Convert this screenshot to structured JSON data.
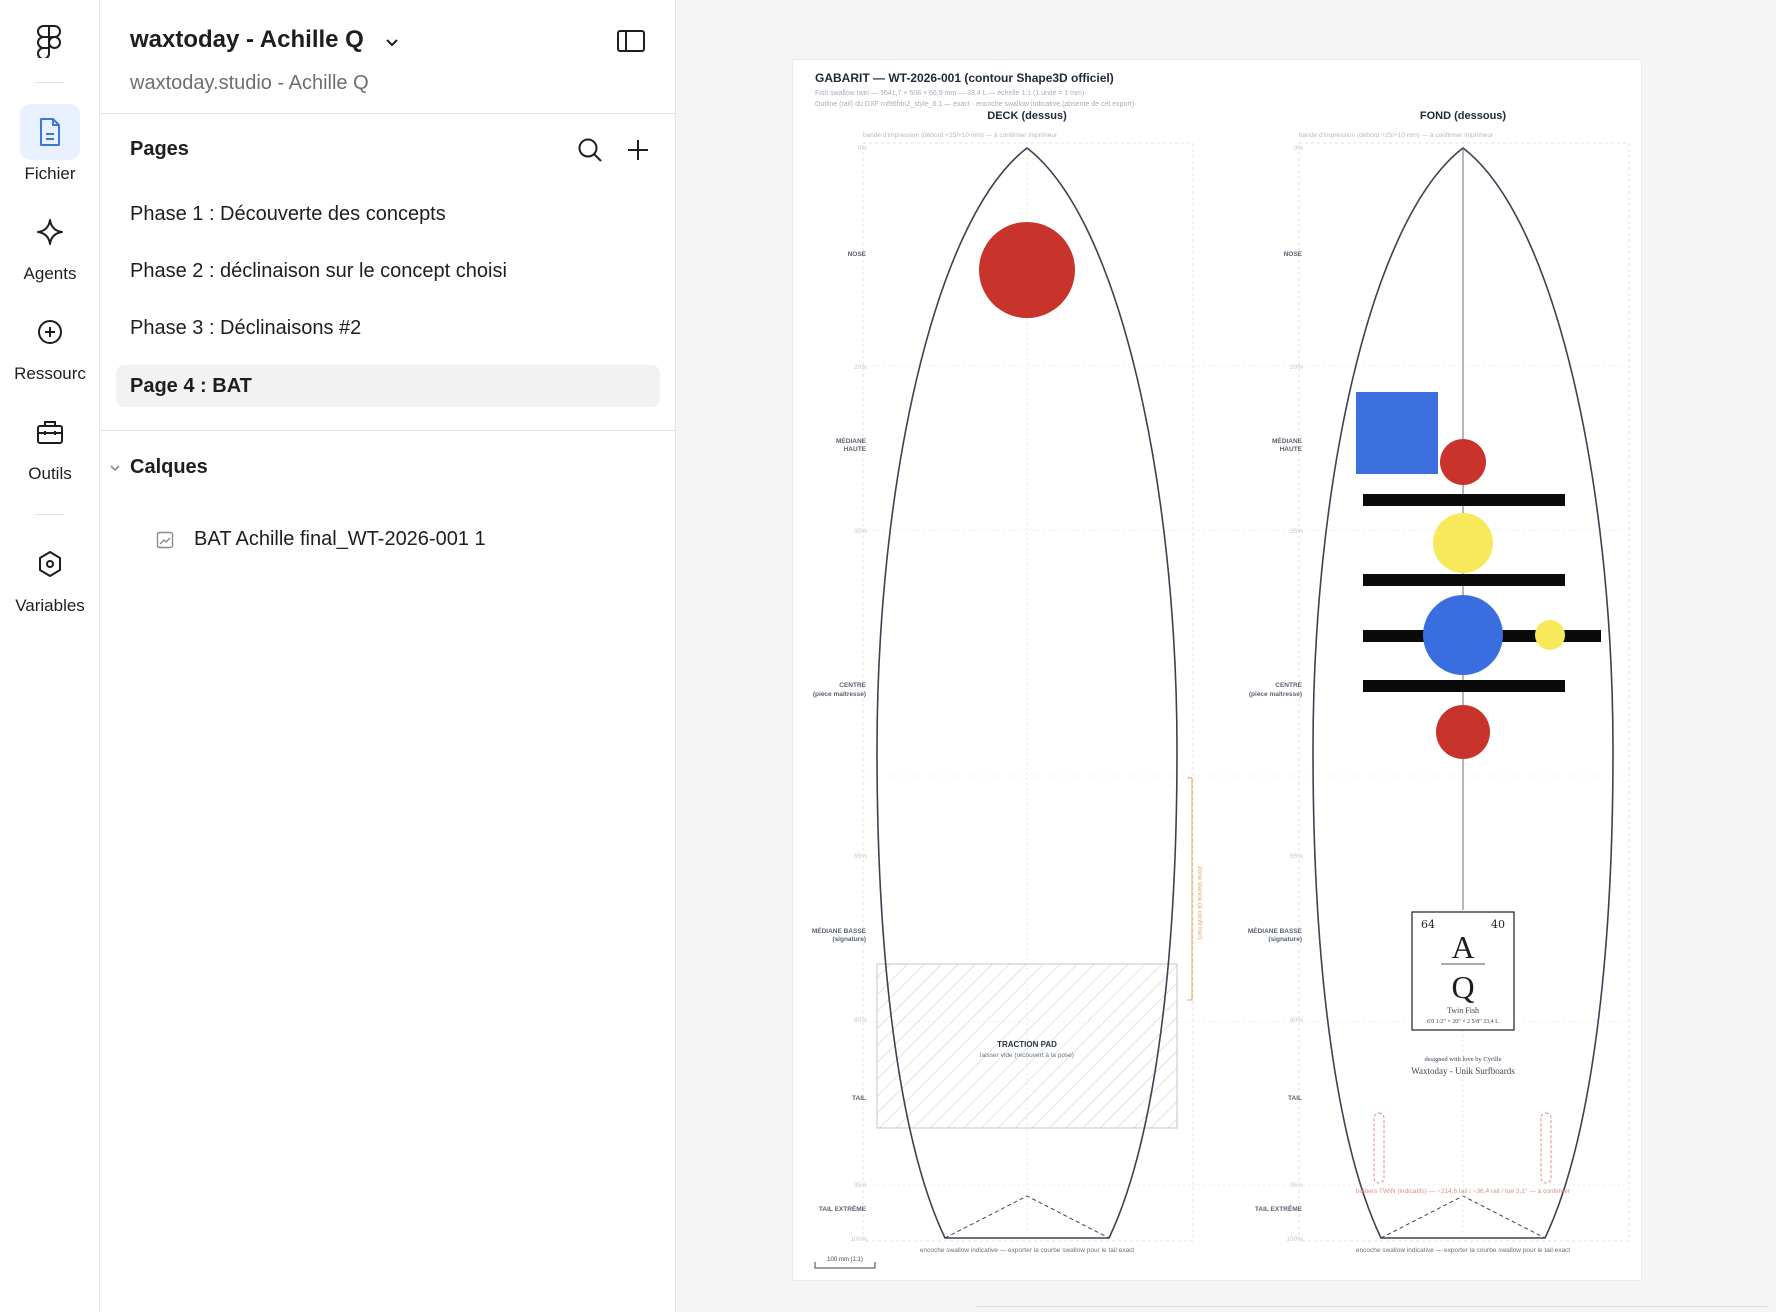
{
  "rail": {
    "items": [
      {
        "label": "Fichier",
        "icon": "file-icon",
        "active": true
      },
      {
        "label": "Agents",
        "icon": "sparkle-icon"
      },
      {
        "label": "Ressourc",
        "icon": "plus-circle-icon"
      },
      {
        "label": "Outils",
        "icon": "toolbox-icon"
      },
      {
        "label": "Variables",
        "icon": "hexagon-icon"
      }
    ]
  },
  "sidebar": {
    "file_title": "waxtoday - Achille Q",
    "file_subtitle": "waxtoday.studio - Achille Q",
    "pages_title": "Pages",
    "pages": [
      {
        "label": "Phase 1 : Découverte des concepts"
      },
      {
        "label": "Phase 2 : déclinaison sur le concept choisi"
      },
      {
        "label": "Phase 3 : Déclinaisons #2"
      },
      {
        "label": "Page 4 : BAT",
        "active": true
      }
    ],
    "layers_title": "Calques",
    "layers": [
      {
        "label": "BAT Achille final_WT-2026-001 1",
        "icon": "image-icon"
      }
    ]
  },
  "artboard": {
    "title": "GABARIT — WT-2026-001 (contour Shape3D officiel)",
    "subtitle_1": "Fish swallow twin — 1641,7 × 508 × 66,9 mm — 33,4 L — échelle 1:1 (1 unité = 1 mm)",
    "subtitle_2": "Outline (rail) du DXF rnf96fdn2_style_6.1 — exact · encoche swallow indicative (absente de cet export)",
    "deck": {
      "heading": "DECK (dessus)",
      "bleed_note": "bande d'impression (débord +25/+10 mm) — à confirmer imprimeur",
      "traction_title": "TRACTION PAD",
      "traction_sub": "laisser vide (recouvert à la pose)",
      "stance_note": "zone stance (à confirmer)",
      "tail_note": "encoche swallow indicative — exporter la courbe swallow pour le tail exact",
      "scale": "100 mm (1:1)"
    },
    "fond": {
      "heading": "FOND (dessous)",
      "bleed_note": "bande d'impression (débord +25/+10 mm) — à confirmer imprimeur",
      "fin_note": "boîtiers TWIN (indicatifs) — ~214,6 tail / ~36,4 rail / toe 3,1° — à confirmer",
      "tail_note": "encoche swallow indicative — exporter la courbe swallow pour le tail exact",
      "tile": {
        "num_left": "64",
        "num_right": "40",
        "letter_top": "A",
        "letter_bottom": "Q",
        "name": "Twin Fish",
        "dims": "6'0 1/2\" × 20\" × 2 5/8\" 33,4 L"
      },
      "credit_1": "designed with love by Cyrille",
      "credit_2": "Waxtoday - Unik Surfboards"
    },
    "zones": [
      {
        "label": "NOSE"
      },
      {
        "label": "MÉDIANE",
        "label2": "HAUTE"
      },
      {
        "label": "CENTRE",
        "label2": "(pièce maîtresse)"
      },
      {
        "label": "MÉDIANE BASSE",
        "label2": "(signature)"
      },
      {
        "label": "TAIL"
      },
      {
        "label": "TAIL EXTRÊME"
      }
    ],
    "percents": [
      "0%",
      "20%",
      "35%",
      "65%",
      "80%",
      "95%",
      "100%"
    ],
    "colors": {
      "red": "#c8342b",
      "blue": "#3a6ee0",
      "blue_square": "#3b6fde",
      "yellow": "#f7e95a",
      "outline": "#3c4250",
      "fin": "#e08b8b",
      "stance": "#e2a65a"
    }
  }
}
